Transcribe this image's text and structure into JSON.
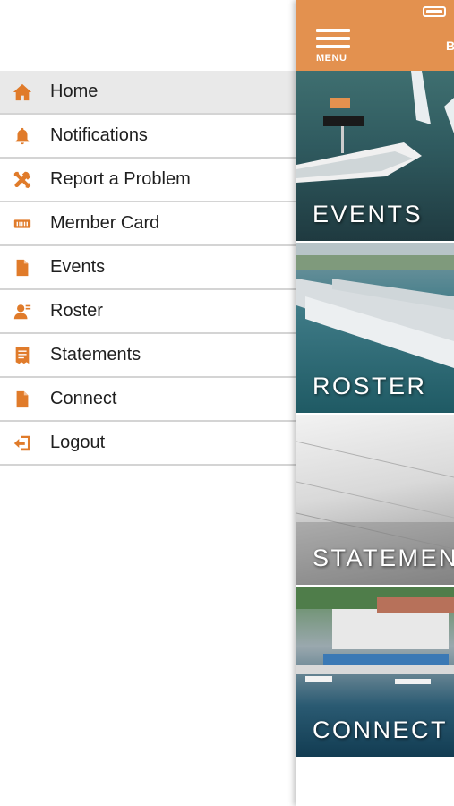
{
  "drawer": {
    "items": [
      {
        "label": "Home",
        "icon": "home-icon",
        "active": true
      },
      {
        "label": "Notifications",
        "icon": "bell-icon",
        "active": false
      },
      {
        "label": "Report a Problem",
        "icon": "tools-icon",
        "active": false
      },
      {
        "label": "Member Card",
        "icon": "card-icon",
        "active": false
      },
      {
        "label": "Events",
        "icon": "document-icon",
        "active": false
      },
      {
        "label": "Roster",
        "icon": "person-icon",
        "active": false
      },
      {
        "label": "Statements",
        "icon": "statement-icon",
        "active": false
      },
      {
        "label": "Connect",
        "icon": "document-icon",
        "active": false
      },
      {
        "label": "Logout",
        "icon": "logout-icon",
        "active": false
      }
    ]
  },
  "topbar": {
    "menu_label": "MENU",
    "cut_off_text": "B"
  },
  "tiles": {
    "events": "EVENTS",
    "roster": "ROSTER",
    "statements": "STATEMENTS",
    "connect": "CONNECT"
  },
  "colors": {
    "accent": "#e3914f",
    "icon": "#e07b2a",
    "active_row": "#e9e9e9",
    "divider": "#d4d4d4"
  }
}
